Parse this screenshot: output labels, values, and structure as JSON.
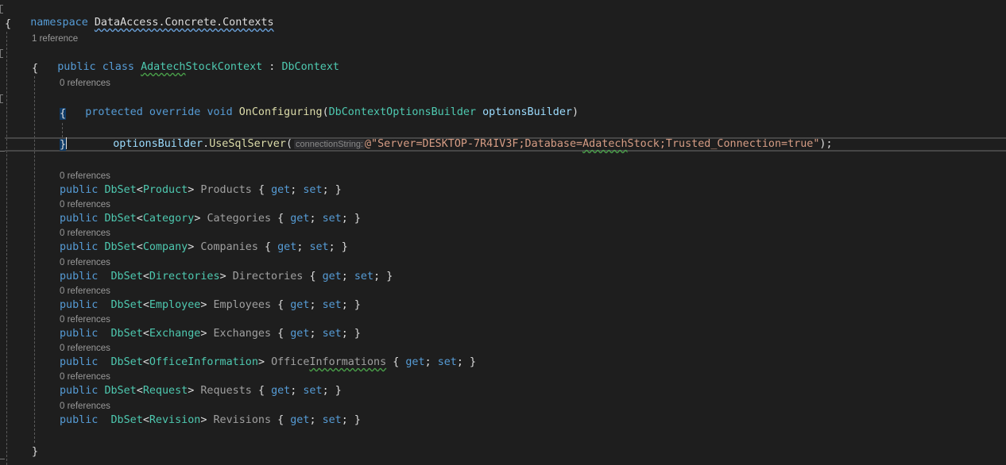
{
  "namespace_line": {
    "keyword": "namespace",
    "name": "DataAccess.Concrete.Contexts"
  },
  "class_decl": {
    "codelens": "1 reference",
    "modifier": "public",
    "keyword": "class",
    "name": "AdatechStockContext",
    "colon": " : ",
    "base": "DbContext"
  },
  "method_decl": {
    "codelens": "0 references",
    "modifiers": [
      "protected",
      "override",
      "void"
    ],
    "name": "OnConfiguring",
    "param_type": "DbContextOptionsBuilder",
    "param_name": "optionsBuilder"
  },
  "method_body": {
    "object": "optionsBuilder",
    "method": "UseSqlServer",
    "param_hint": "connectionString:",
    "string_prefix": "@\"Server=DESKTOP-7R4IV3F;Database=",
    "string_squiggle": "Adatech",
    "string_suffix": "Stock;Trusted_Connection=true\"",
    "end": ");"
  },
  "braces": {
    "open": "{",
    "close": "}"
  },
  "properties": [
    {
      "codelens": "0 references",
      "modifier": "public",
      "generic": "DbSet",
      "type": "Product",
      "name": "Products",
      "accessors": "{ get; set; }",
      "extra_space": false
    },
    {
      "codelens": "0 references",
      "modifier": "public",
      "generic": "DbSet",
      "type": "Category",
      "name": "Categories",
      "accessors": "{ get; set; }",
      "extra_space": false
    },
    {
      "codelens": "0 references",
      "modifier": "public",
      "generic": "DbSet",
      "type": "Company",
      "name": "Companies",
      "accessors": "{ get; set; }",
      "extra_space": false
    },
    {
      "codelens": "0 references",
      "modifier": "public",
      "generic": "DbSet",
      "type": "Directories",
      "name": "Directories",
      "accessors": "{ get; set; }",
      "extra_space": true
    },
    {
      "codelens": "0 references",
      "modifier": "public",
      "generic": "DbSet",
      "type": "Employee",
      "name": "Employees",
      "accessors": "{ get; set; }",
      "extra_space": true
    },
    {
      "codelens": "0 references",
      "modifier": "public",
      "generic": "DbSet",
      "type": "Exchange",
      "name": "Exchanges",
      "accessors": "{ get; set; }",
      "extra_space": true
    },
    {
      "codelens": "0 references",
      "modifier": "public",
      "generic": "DbSet",
      "type": "OfficeInformation",
      "name": "OfficeInformations",
      "accessors": "{ get; set; }",
      "extra_space": true
    },
    {
      "codelens": "0 references",
      "modifier": "public",
      "generic": "DbSet",
      "type": "Request",
      "name": "Requests",
      "accessors": "{ get; set; }",
      "extra_space": false
    },
    {
      "codelens": "0 references",
      "modifier": "public",
      "generic": "DbSet",
      "type": "Revision",
      "name": "Revisions",
      "accessors": "{ get; set; }",
      "extra_space": true
    }
  ]
}
